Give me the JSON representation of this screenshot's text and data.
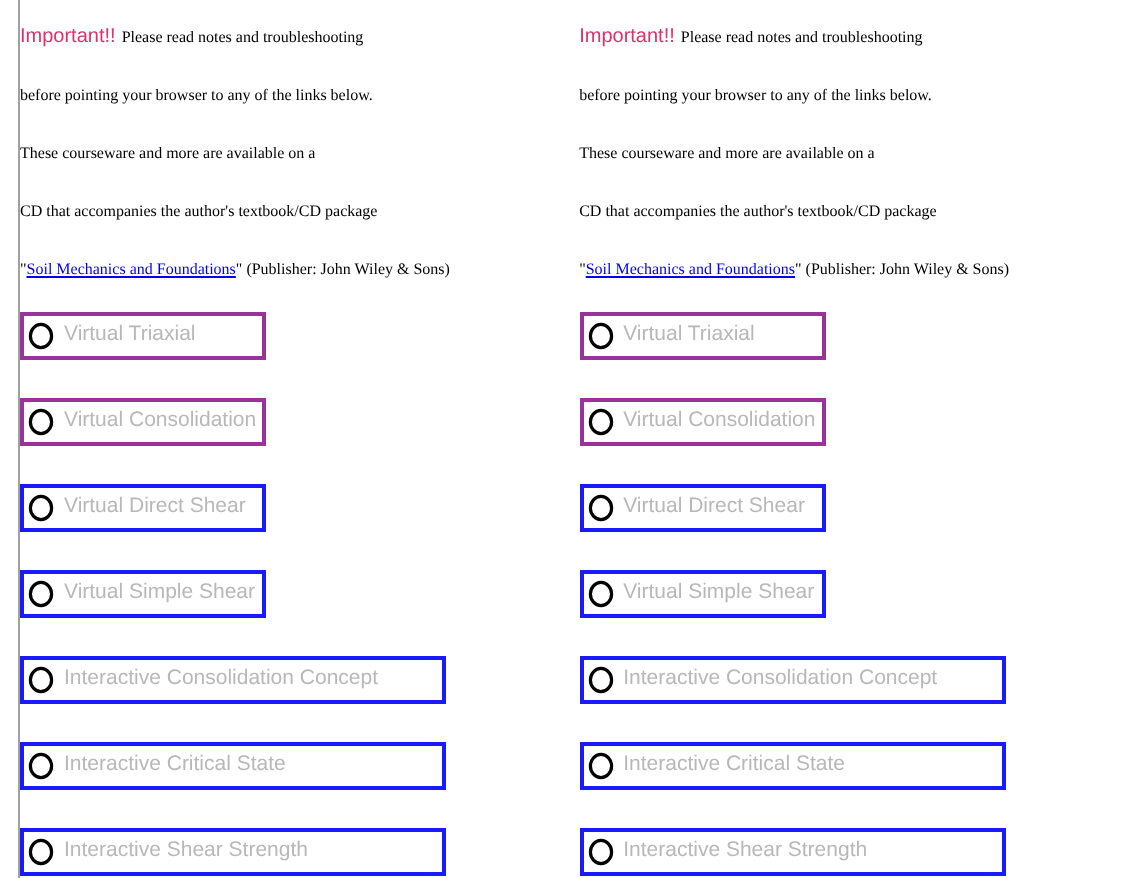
{
  "columns": [
    {
      "rule": true,
      "important": "Important!!",
      "lines": [
        "Please read notes and troubleshooting",
        "before pointing your browser to any of the links below.",
        "These courseware and more are available on a",
        "CD that accompanies the author's textbook/CD package"
      ],
      "quote_open": "\"",
      "book_link": "Soil Mechanics and Foundations",
      "credit": "\" (Publisher: John Wiley & Sons)",
      "links": [
        {
          "label": "Virtual Triaxial",
          "kind": "short",
          "color": "#993399"
        },
        {
          "label": "Virtual Consolidation",
          "kind": "short",
          "color": "#993399"
        },
        {
          "label": "Virtual Direct Shear",
          "kind": "short",
          "color": "#1a1aff"
        },
        {
          "label": "Virtual Simple Shear",
          "kind": "short",
          "color": "#1a1aff"
        },
        {
          "label": "Interactive Consolidation Concept",
          "kind": "long",
          "color": "#1a1aff"
        },
        {
          "label": "Interactive Critical State",
          "kind": "long",
          "color": "#1a1aff"
        },
        {
          "label": "Interactive Shear Strength",
          "kind": "long",
          "color": "#1a1aff"
        }
      ]
    },
    {
      "rule": false,
      "important": "Important!!",
      "lines": [
        "Please read notes and troubleshooting",
        "before pointing your browser to any of the links below.",
        "These courseware and more are available on a",
        "CD that accompanies the author's textbook/CD package"
      ],
      "quote_open": "\"",
      "book_link": "Soil Mechanics and Foundations",
      "credit": "\" (Publisher: John Wiley & Sons)",
      "links": [
        {
          "label": "Virtual Triaxial",
          "kind": "short",
          "color": "#993399"
        },
        {
          "label": "Virtual Consolidation",
          "kind": "short",
          "color": "#993399"
        },
        {
          "label": "Virtual Direct Shear",
          "kind": "short",
          "color": "#1a1aff"
        },
        {
          "label": "Virtual Simple Shear",
          "kind": "short",
          "color": "#1a1aff"
        },
        {
          "label": "Interactive Consolidation Concept",
          "kind": "long",
          "color": "#1a1aff"
        },
        {
          "label": "Interactive Critical State",
          "kind": "long",
          "color": "#1a1aff"
        },
        {
          "label": "Interactive Shear Strength",
          "kind": "long",
          "color": "#1a1aff"
        }
      ]
    }
  ]
}
